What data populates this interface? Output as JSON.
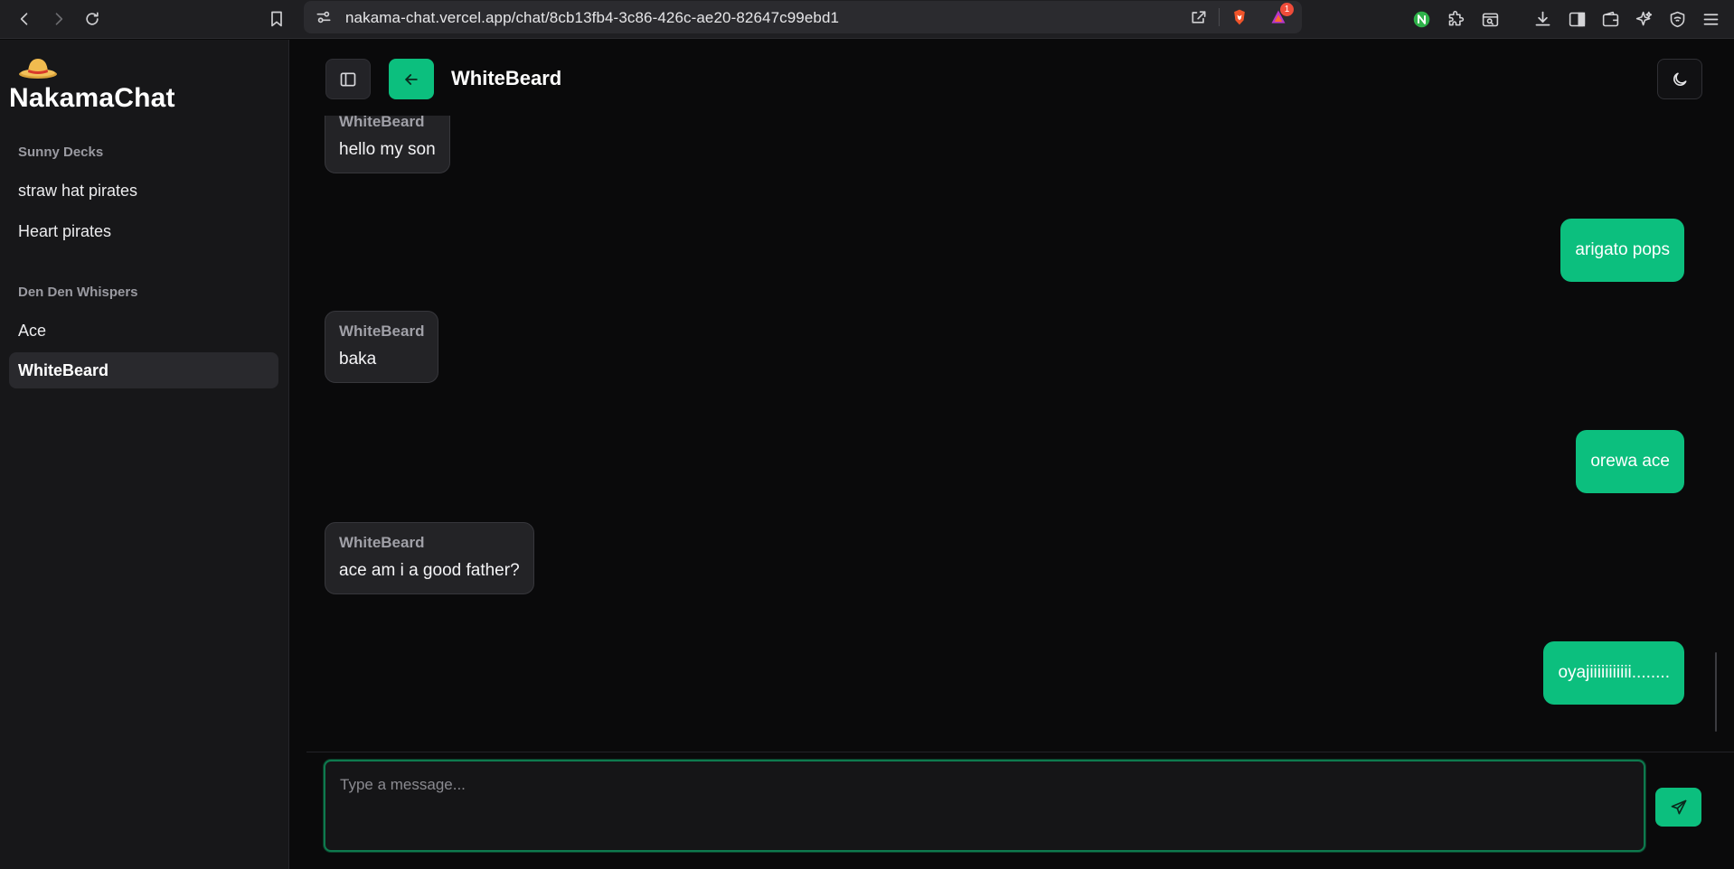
{
  "browser": {
    "url": "nakama-chat.vercel.app/chat/8cb13fb4-3c86-426c-ae20-82647c99ebd1",
    "notification_count": "1",
    "icons": [
      "back-icon",
      "forward-icon",
      "reload-icon",
      "bookmark-icon",
      "site-settings-icon",
      "share-icon",
      "brave-shield-icon",
      "brave-rewards-icon",
      "extension-n-icon",
      "extensions-puzzle-icon",
      "search-tab-icon",
      "download-icon",
      "sidebar-icon",
      "wallet-icon",
      "leo-ai-icon",
      "vpn-icon",
      "menu-icon"
    ]
  },
  "sidebar": {
    "brand_emoji": "👒",
    "brand_title": "NakamaChat",
    "sections": [
      {
        "label": "Sunny Decks",
        "items": [
          {
            "label": "straw hat pirates",
            "active": false
          },
          {
            "label": "Heart pirates",
            "active": false
          }
        ]
      },
      {
        "label": "Den Den Whispers",
        "items": [
          {
            "label": "Ace",
            "active": false
          },
          {
            "label": "WhiteBeard",
            "active": true
          }
        ]
      }
    ]
  },
  "header": {
    "title": "WhiteBeard",
    "icons": [
      "sidebar-toggle-icon",
      "arrow-left-icon",
      "moon-icon"
    ]
  },
  "messages": [
    {
      "direction": "in",
      "sender": "WhiteBeard",
      "text": "hello my son"
    },
    {
      "direction": "out",
      "text": "arigato pops"
    },
    {
      "direction": "in",
      "sender": "WhiteBeard",
      "text": "baka"
    },
    {
      "direction": "out",
      "text": "orewa ace"
    },
    {
      "direction": "in",
      "sender": "WhiteBeard",
      "text": "ace am i a good father?"
    },
    {
      "direction": "out",
      "text": "oyajiiiiiiiiiii........"
    }
  ],
  "composer": {
    "placeholder": "Type a message...",
    "value": "",
    "send_icon": "send-icon"
  },
  "colors": {
    "accent": "#0cbf7e",
    "background": "#0a0a0b",
    "sidebar": "#171719",
    "bubble_in": "#232326"
  }
}
